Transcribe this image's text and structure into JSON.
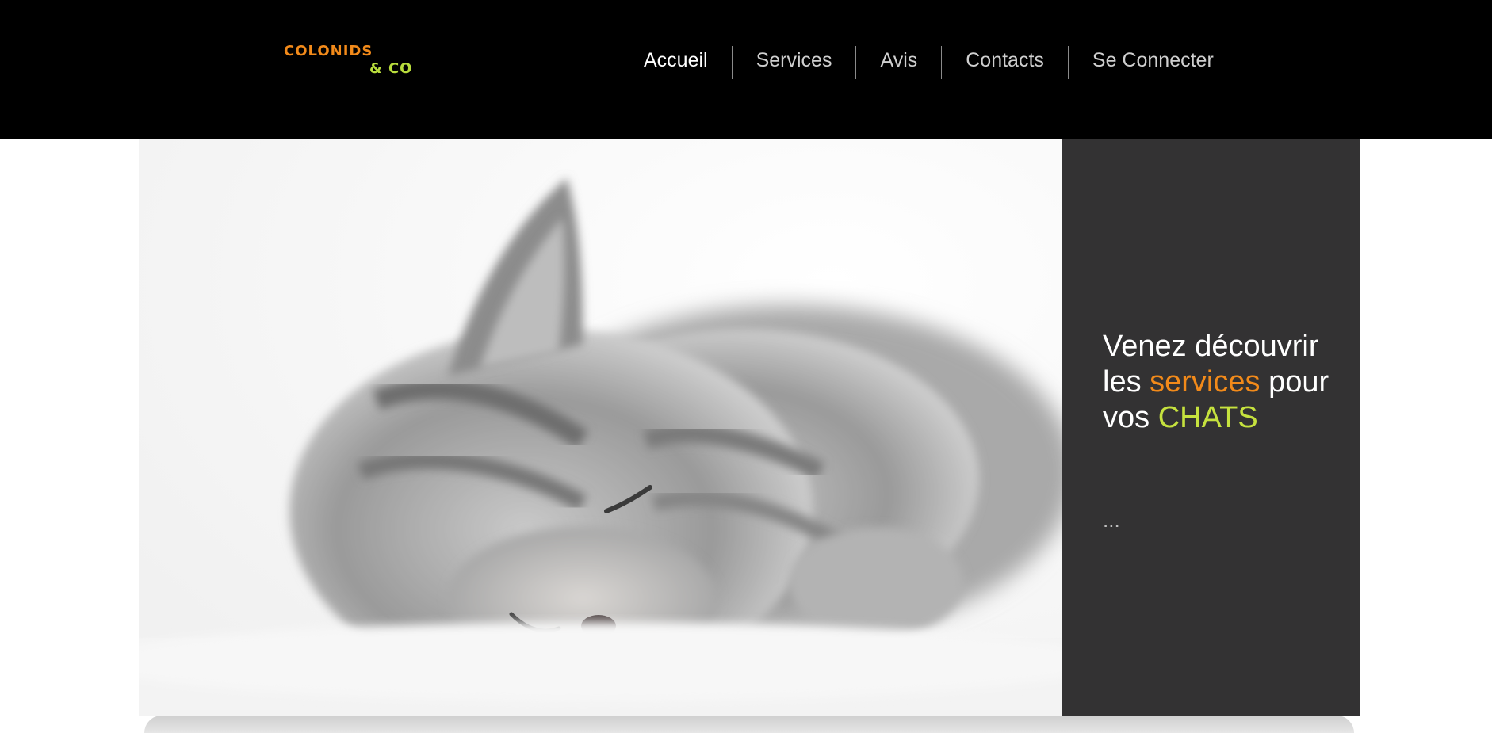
{
  "brand": {
    "line1": "COLONIDS",
    "line2": "& CO"
  },
  "nav": {
    "items": [
      {
        "label": "Accueil",
        "active": true
      },
      {
        "label": "Services",
        "active": false
      },
      {
        "label": "Avis",
        "active": false
      },
      {
        "label": "Contacts",
        "active": false
      },
      {
        "label": "Se Connecter",
        "active": false
      }
    ]
  },
  "hero": {
    "image_subject": "sleeping grey kitten",
    "tagline": {
      "part1": "Venez découvrir les",
      "highlight1": "services",
      "part2": "pour vos",
      "highlight2": "CHATS"
    },
    "ellipsis": "..."
  },
  "colors": {
    "accent_orange": "#f28a1a",
    "accent_green": "#c6e23e",
    "header_bg": "#000000",
    "panel_bg": "#333233"
  }
}
